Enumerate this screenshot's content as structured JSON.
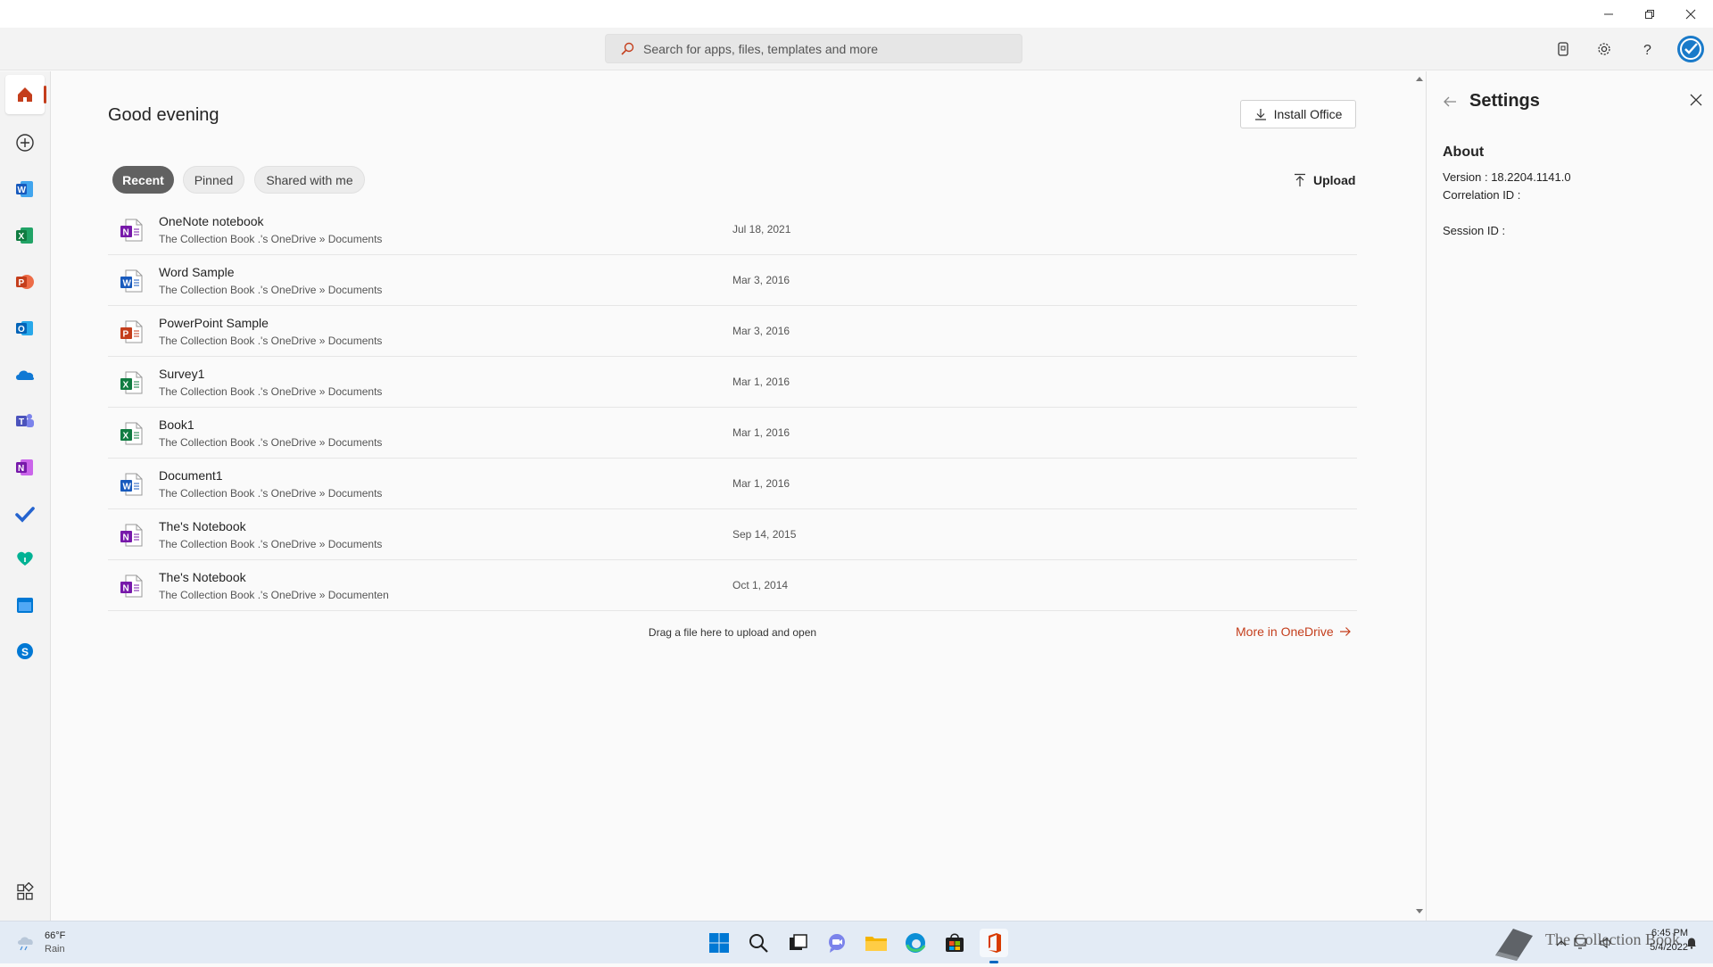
{
  "header": {
    "search_placeholder": "Search for apps, files, templates and more"
  },
  "main": {
    "greeting": "Good evening",
    "install_label": "Install Office",
    "tabs": [
      {
        "label": "Recent",
        "active": true
      },
      {
        "label": "Pinned",
        "active": false
      },
      {
        "label": "Shared with me",
        "active": false
      }
    ],
    "upload_label": "Upload",
    "files": [
      {
        "name": "OneNote notebook",
        "path": "The Collection Book .'s OneDrive » Documents",
        "date": "Jul 18, 2021",
        "app": "onenote"
      },
      {
        "name": "Word Sample",
        "path": "The Collection Book .'s OneDrive » Documents",
        "date": "Mar 3, 2016",
        "app": "word"
      },
      {
        "name": "PowerPoint Sample",
        "path": "The Collection Book .'s OneDrive » Documents",
        "date": "Mar 3, 2016",
        "app": "powerpoint"
      },
      {
        "name": "Survey1",
        "path": "The Collection Book .'s OneDrive » Documents",
        "date": "Mar 1, 2016",
        "app": "excel"
      },
      {
        "name": "Book1",
        "path": "The Collection Book .'s OneDrive » Documents",
        "date": "Mar 1, 2016",
        "app": "excel"
      },
      {
        "name": "Document1",
        "path": "The Collection Book .'s OneDrive » Documents",
        "date": "Mar 1, 2016",
        "app": "word"
      },
      {
        "name": "The's Notebook",
        "path": "The Collection Book .'s OneDrive » Documents",
        "date": "Sep 14, 2015",
        "app": "onenote"
      },
      {
        "name": "The's Notebook",
        "path": "The Collection Book .'s OneDrive » Documenten",
        "date": "Oct 1, 2014",
        "app": "onenote"
      }
    ],
    "drop_note": "Drag a file here to upload and open",
    "more_link": "More in OneDrive"
  },
  "settings": {
    "title": "Settings",
    "about_heading": "About",
    "version": "Version : 18.2204.1141.0",
    "correlation": "Correlation ID :",
    "session": "Session ID :"
  },
  "taskbar": {
    "weather_temp": "66°F",
    "weather_desc": "Rain",
    "time": "6:45 PM",
    "date": "5/4/2022",
    "watermark": "The Collection Book"
  },
  "colors": {
    "accent": "#c43e1c",
    "word": "#185abd",
    "excel": "#107c41",
    "powerpoint": "#c43e1c",
    "onenote": "#7719aa"
  }
}
